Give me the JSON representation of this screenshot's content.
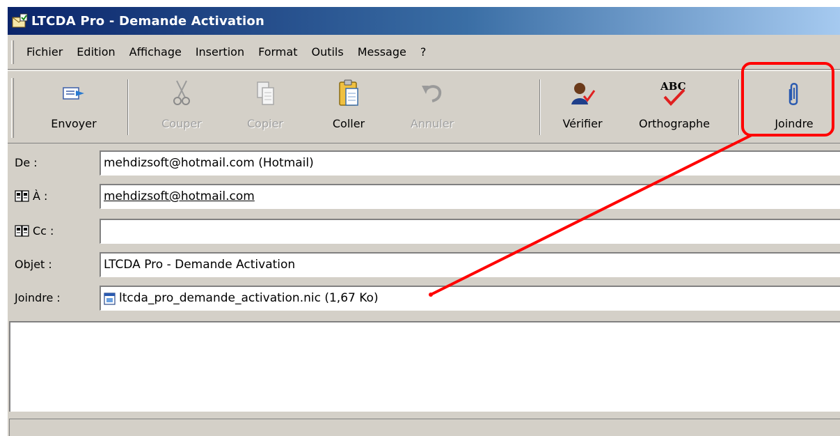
{
  "window": {
    "title": "LTCDA Pro - Demande Activation"
  },
  "menu": [
    "Fichier",
    "Edition",
    "Affichage",
    "Insertion",
    "Format",
    "Outils",
    "Message",
    "?"
  ],
  "toolbar": {
    "send": "Envoyer",
    "cut": "Couper",
    "copy": "Copier",
    "paste": "Coller",
    "undo": "Annuler",
    "check": "Vérifier",
    "spelling": "Orthographe",
    "spelling_icon_text": "ABC",
    "attach": "Joindre"
  },
  "fields": {
    "from_label": "De :",
    "from_value": "mehdizsoft@hotmail.com     (Hotmail)",
    "to_label": "À :",
    "to_value": "mehdizsoft@hotmail.com",
    "cc_label": "Cc :",
    "cc_value": "",
    "subject_label": "Objet :",
    "subject_value": "LTCDA Pro - Demande Activation",
    "attach_label": "Joindre :",
    "attach_value": "ltcda_pro_demande_activation.nic (1,67 Ko)"
  },
  "colors": {
    "titlebar_start": "#0a246a",
    "titlebar_end": "#a6caf0",
    "face": "#d4d0c8",
    "annotation": "#ff0000"
  }
}
